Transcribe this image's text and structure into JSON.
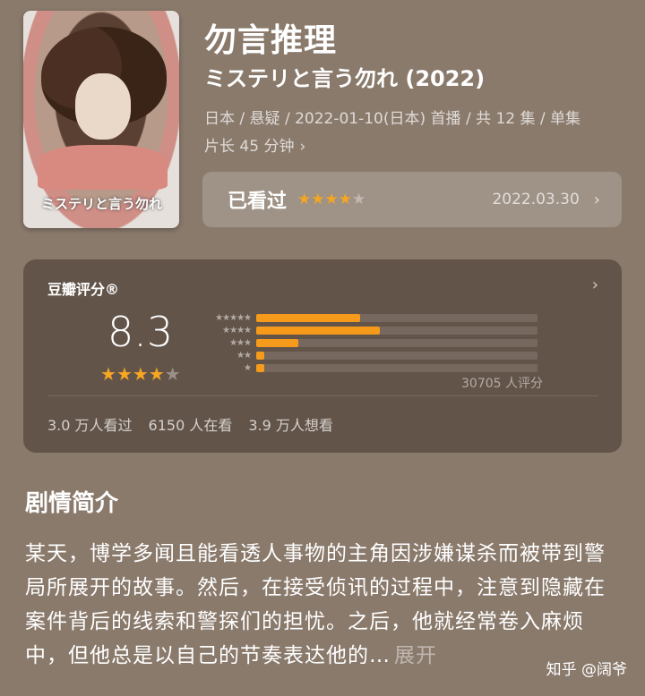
{
  "poster": {
    "title": "ミステリと言う勿れ"
  },
  "header": {
    "title": "勿言推理",
    "subtitle": "ミステリと言う勿れ (2022)",
    "meta_line1": "日本 / 悬疑 / 2022-01-10(日本) 首播 / 共 12 集 / 单集",
    "meta_line2": "片长 45 分钟",
    "meta_chevron": "›"
  },
  "watched": {
    "label": "已看过",
    "rating": 4,
    "date": "2022.03.30",
    "chevron": "›"
  },
  "douban": {
    "label": "豆瓣评分®",
    "chevron": "›",
    "score": "8.3",
    "score_stars": 4,
    "distribution": [
      {
        "stars": "★★★★★",
        "fraction": 0.37
      },
      {
        "stars": "★★★★",
        "fraction": 0.44
      },
      {
        "stars": "★★★",
        "fraction": 0.15
      },
      {
        "stars": "★★",
        "fraction": 0.03
      },
      {
        "stars": "★",
        "fraction": 0.03
      }
    ],
    "votes": "30705 人评分",
    "stats": [
      "3.0 万人看过",
      "6150 人在看",
      "3.9 万人想看"
    ]
  },
  "synopsis": {
    "title": "剧情简介",
    "text": "某天，博学多闻且能看透人事物的主角因涉嫌谋杀而被带到警局所展开的故事。然后，在接受侦讯的过程中，注意到隐藏在案件背后的线索和警探们的担忧。之后，他就经常卷入麻烦中，但他总是以自己的节奏表达他的…",
    "expand": "展开"
  },
  "watermark": "知乎 @阔爷",
  "colors": {
    "accent": "#f59a1b",
    "background": "#8a7a6c"
  }
}
